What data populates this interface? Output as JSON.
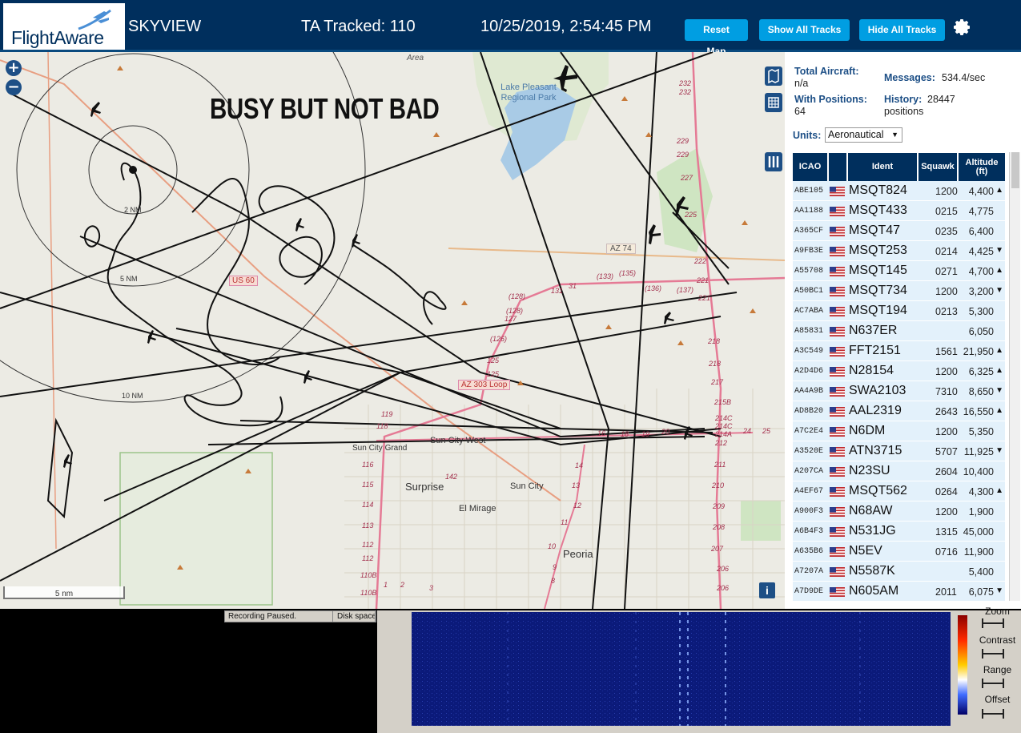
{
  "header": {
    "logo_text": "FlightAware",
    "app_name": "SKYVIEW",
    "ta_tracked": "TA Tracked: 110",
    "datetime": "10/25/2019, 2:54:45 PM",
    "reset_map": "Reset Map",
    "show_all": "Show All Tracks",
    "hide_all": "Hide All Tracks"
  },
  "map": {
    "overlay_text": "BUSY BUT NOT BAD",
    "scale_label": "5 nm",
    "ring_labels": [
      "2 NM",
      "5 NM",
      "10 NM"
    ],
    "place_labels": [
      "Area",
      "Lake Pleasant Regional Park",
      "Sun City West",
      "Sun City Grand",
      "Surprise",
      "Sun City",
      "El Mirage",
      "Peoria"
    ],
    "road_labels": [
      "US 60",
      "AZ 74",
      "AZ 303 Loop"
    ],
    "route_numbers_303": [
      "232",
      "232",
      "229",
      "229",
      "227",
      "225",
      "222",
      "221",
      "221",
      "218",
      "218",
      "217",
      "215B",
      "214C",
      "214C",
      "214A",
      "212",
      "211",
      "210",
      "209",
      "208",
      "207",
      "206",
      "206"
    ],
    "route_numbers_loop": [
      "(137)",
      "(136)",
      "(135)",
      "(133)",
      "131",
      "31",
      "(128)",
      "(128)",
      "127",
      "(126)",
      "125",
      "125",
      "119",
      "118",
      "116",
      "115",
      "114",
      "113",
      "112",
      "112",
      "110B",
      "110B",
      "142",
      "14",
      "13",
      "12",
      "11",
      "10",
      "9",
      "8",
      "16",
      "18",
      "19",
      "20",
      "24",
      "25",
      "1",
      "2",
      "3"
    ]
  },
  "panel": {
    "total_aircraft_label": "Total Aircraft:",
    "total_aircraft_value": "n/a",
    "with_positions_label": "With Positions:",
    "with_positions_value": "64",
    "messages_label": "Messages:",
    "messages_value": "534.4/sec",
    "history_label": "History:",
    "history_value": "28447",
    "history_unit": "positions",
    "units_label": "Units:",
    "units_value": "Aeronautical",
    "columns": [
      "ICAO",
      "",
      "Ident",
      "Squawk",
      "Altitude (ft)"
    ],
    "rows": [
      {
        "icao": "ABE105",
        "ident": "MSQT824",
        "squawk": "1200",
        "alt": "4,400",
        "trend": "▲"
      },
      {
        "icao": "AA1188",
        "ident": "MSQT433",
        "squawk": "0215",
        "alt": "4,775",
        "trend": ""
      },
      {
        "icao": "A365CF",
        "ident": "MSQT47",
        "squawk": "0235",
        "alt": "6,400",
        "trend": ""
      },
      {
        "icao": "A9FB3E",
        "ident": "MSQT253",
        "squawk": "0214",
        "alt": "4,425",
        "trend": "▼"
      },
      {
        "icao": "A55708",
        "ident": "MSQT145",
        "squawk": "0271",
        "alt": "4,700",
        "trend": "▲"
      },
      {
        "icao": "A50BC1",
        "ident": "MSQT734",
        "squawk": "1200",
        "alt": "3,200",
        "trend": "▼"
      },
      {
        "icao": "AC7ABA",
        "ident": "MSQT194",
        "squawk": "0213",
        "alt": "5,300",
        "trend": ""
      },
      {
        "icao": "A85831",
        "ident": "N637ER",
        "squawk": "",
        "alt": "6,050",
        "trend": ""
      },
      {
        "icao": "A3C549",
        "ident": "FFT2151",
        "squawk": "1561",
        "alt": "21,950",
        "trend": "▲"
      },
      {
        "icao": "A2D4D6",
        "ident": "N28154",
        "squawk": "1200",
        "alt": "6,325",
        "trend": "▲"
      },
      {
        "icao": "AA4A9B",
        "ident": "SWA2103",
        "squawk": "7310",
        "alt": "8,650",
        "trend": "▼"
      },
      {
        "icao": "AD8B20",
        "ident": "AAL2319",
        "squawk": "2643",
        "alt": "16,550",
        "trend": "▲"
      },
      {
        "icao": "A7C2E4",
        "ident": "N6DM",
        "squawk": "1200",
        "alt": "5,350",
        "trend": ""
      },
      {
        "icao": "A3520E",
        "ident": "ATN3715",
        "squawk": "5707",
        "alt": "11,925",
        "trend": "▼"
      },
      {
        "icao": "A207CA",
        "ident": "N23SU",
        "squawk": "2604",
        "alt": "10,400",
        "trend": ""
      },
      {
        "icao": "A4EF67",
        "ident": "MSQT562",
        "squawk": "0264",
        "alt": "4,300",
        "trend": "▲"
      },
      {
        "icao": "A900F3",
        "ident": "N68AW",
        "squawk": "1200",
        "alt": "1,900",
        "trend": ""
      },
      {
        "icao": "A6B4F3",
        "ident": "N531JG",
        "squawk": "1315",
        "alt": "45,000",
        "trend": ""
      },
      {
        "icao": "A635B6",
        "ident": "N5EV",
        "squawk": "0716",
        "alt": "11,900",
        "trend": ""
      },
      {
        "icao": "A7207A",
        "ident": "N5587K",
        "squawk": "",
        "alt": "5,400",
        "trend": ""
      },
      {
        "icao": "A7D9DE",
        "ident": "N605AM",
        "squawk": "2011",
        "alt": "6,075",
        "trend": "▼"
      }
    ]
  },
  "bottom": {
    "status_recording": "Recording Paused.",
    "status_disk": "Disk space",
    "controls": [
      "Zoom",
      "Contrast",
      "Range",
      "Offset"
    ]
  },
  "colors": {
    "header_bg": "#002f5d",
    "button_bg": "#009ee2",
    "row_bg": "#e3f1fb",
    "map_bg": "#ecebe4"
  }
}
